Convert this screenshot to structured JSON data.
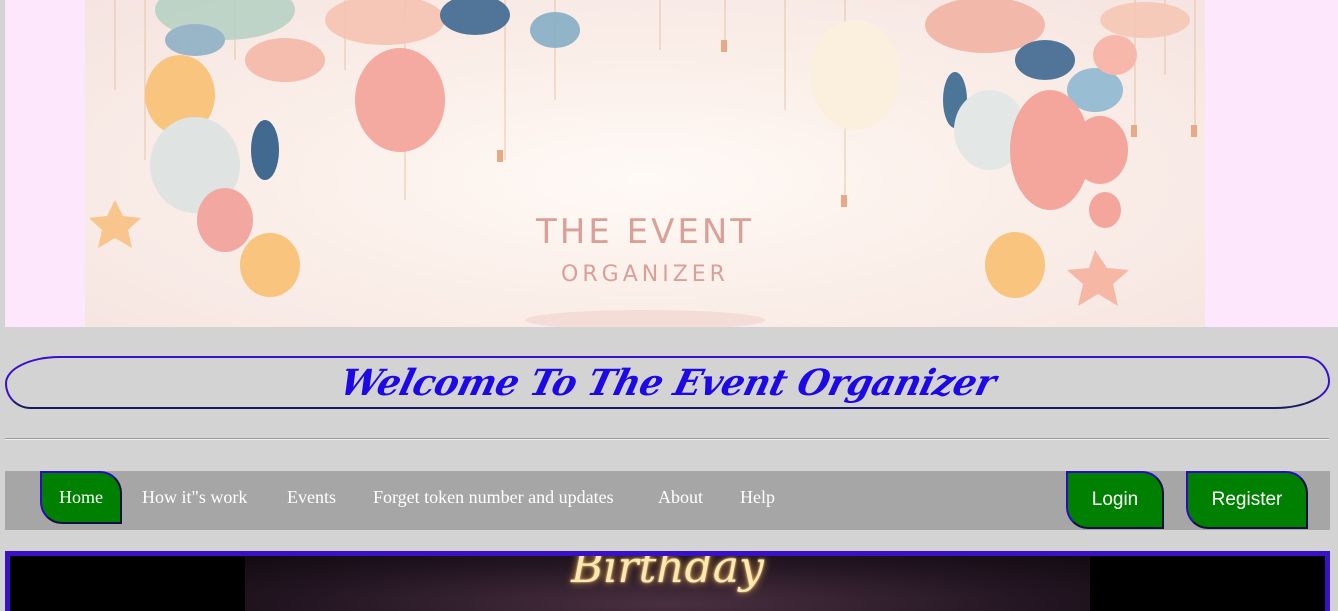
{
  "banner": {
    "title": "THE EVENT",
    "subtitle": "ORGANIZER"
  },
  "welcome": {
    "heading": "Welcome To The Event Organizer"
  },
  "nav": {
    "items": [
      {
        "label": "Home"
      },
      {
        "label": "How it\"s work"
      },
      {
        "label": "Events"
      },
      {
        "label": "Forget token number and updates"
      },
      {
        "label": "About"
      },
      {
        "label": "Help"
      }
    ],
    "login_label": "Login",
    "register_label": "Register"
  },
  "featured": {
    "text": "Birthday"
  },
  "colors": {
    "accent_green": "#008000",
    "border_blue": "#3a10c8",
    "heading_blue": "#1d09e6",
    "nav_bg": "#a6a6a6",
    "page_bg": "#d3d3d3"
  }
}
